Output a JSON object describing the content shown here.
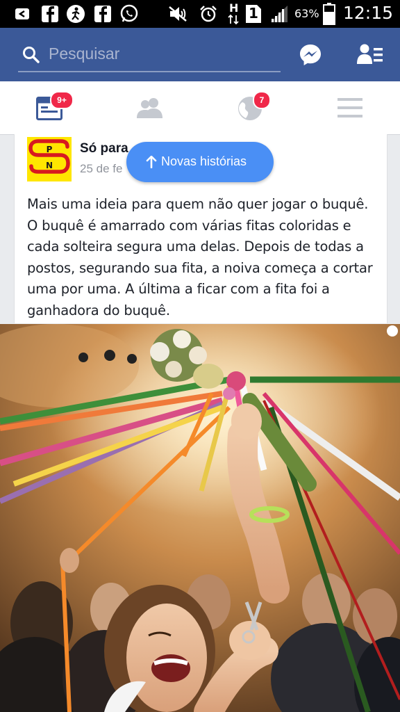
{
  "status_bar": {
    "battery": "63%",
    "time": "12:15",
    "network_letter": "H",
    "sim_number": "1"
  },
  "header": {
    "search_placeholder": "Pesquisar"
  },
  "tabs": {
    "feed_badge": "9+",
    "notifications_badge": "7"
  },
  "post": {
    "author": "Só para",
    "date": "25 de fe",
    "text": "Mais uma ideia para quem não quer jogar o buquê. O buquê é amarrado com várias fitas coloridas e cada solteira segura uma delas. Depois de todas a postos, segurando sua fita, a noiva começa a cortar uma por uma. A última a ficar com a fita foi a ganhadora do buquê.",
    "logo_letters": "S P N"
  },
  "new_stories_label": "Novas histórias",
  "colors": {
    "fb_blue": "#3b5998",
    "badge_red": "#f02849",
    "pill_blue": "#4a8ff5"
  }
}
